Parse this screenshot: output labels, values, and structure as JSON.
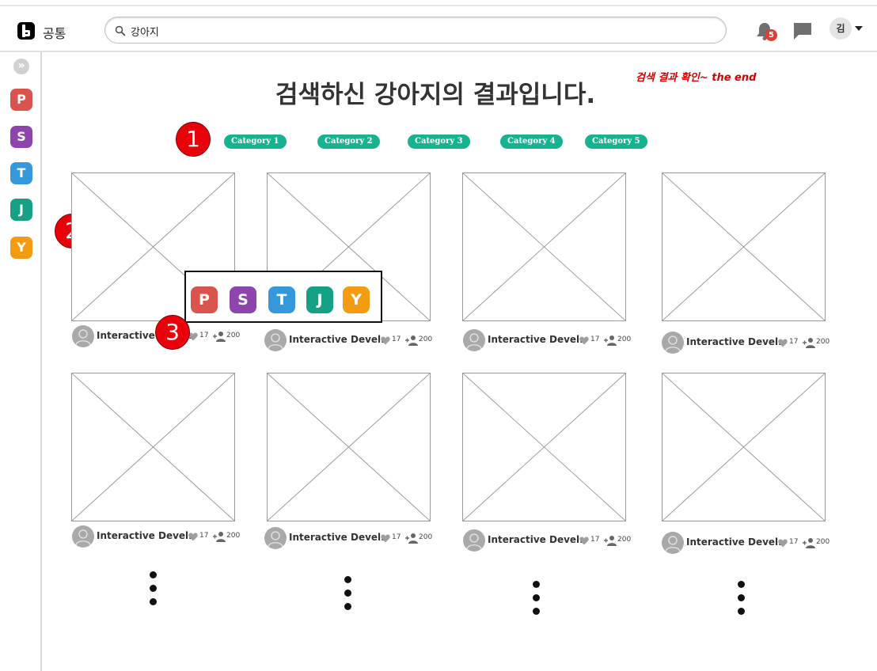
{
  "header": {
    "app_title": "공통",
    "search_value": "강아지",
    "notification_count": "5",
    "user_initial": "김"
  },
  "sidebar": {
    "expand_icon": "double-chevron-right-icon",
    "channels": [
      {
        "letter": "P",
        "color": "#d9534f"
      },
      {
        "letter": "S",
        "color": "#8e44ad"
      },
      {
        "letter": "T",
        "color": "#3498db"
      },
      {
        "letter": "J",
        "color": "#16a085"
      },
      {
        "letter": "Y",
        "color": "#f39c12"
      }
    ]
  },
  "main": {
    "headline": "검색하신 강아지의 결과입니다.",
    "note": "검색 결과 확인~ the end",
    "markers": [
      "1",
      "2",
      "3"
    ],
    "categories": [
      "Category 1",
      "Category 2",
      "Category 3",
      "Category 4",
      "Category 5"
    ],
    "category_color": "#17b391",
    "cards": [
      {
        "author": "Interactive Devel..",
        "likes": "17",
        "followers": "200"
      },
      {
        "author": "Interactive Devel..",
        "likes": "17",
        "followers": "200"
      },
      {
        "author": "Interactive Devel..",
        "likes": "17",
        "followers": "200"
      },
      {
        "author": "Interactive Devel..",
        "likes": "17",
        "followers": "200"
      },
      {
        "author": "Interactive Devel..",
        "likes": "17",
        "followers": "200"
      },
      {
        "author": "Interactive Devel..",
        "likes": "17",
        "followers": "200"
      },
      {
        "author": "Interactive Devel..",
        "likes": "17",
        "followers": "200"
      },
      {
        "author": "Interactive Devel..",
        "likes": "17",
        "followers": "200"
      }
    ],
    "popup_channels": [
      "P",
      "S",
      "T",
      "J",
      "Y"
    ]
  }
}
